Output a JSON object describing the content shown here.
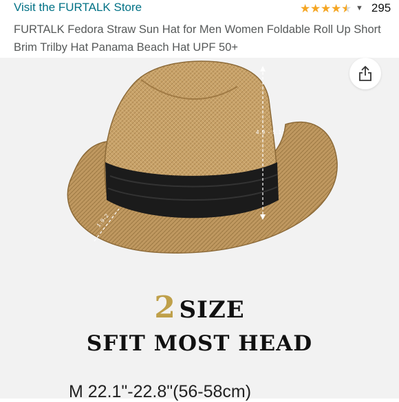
{
  "store": {
    "link_label": "Visit the FURTALK Store"
  },
  "rating": {
    "review_count": "295",
    "stars": 4.5
  },
  "product": {
    "title": "FURTALK Fedora Straw Sun Hat for Men Women Foldable Roll Up Short Brim Trilby Hat Panama Beach Hat UPF 50+"
  },
  "image": {
    "height_measure": "4.9 - 5.1\"",
    "brim_measure": "1.9-2",
    "size_number": "2",
    "size_word": "SIZE",
    "fit_text": "SFIT MOST HEAD",
    "dimension_text": "M  22.1\"-22.8\"(56-58cm)"
  },
  "colors": {
    "link": "#007185",
    "star": "#f5a623",
    "background": "#f2f2f2",
    "hat_straw": "#c9a36a",
    "hat_band": "#1b1b1b",
    "size_number": "#bfa04a"
  },
  "icons": {
    "share": "share-icon",
    "caret": "chevron-down-icon",
    "star": "star-icon"
  }
}
